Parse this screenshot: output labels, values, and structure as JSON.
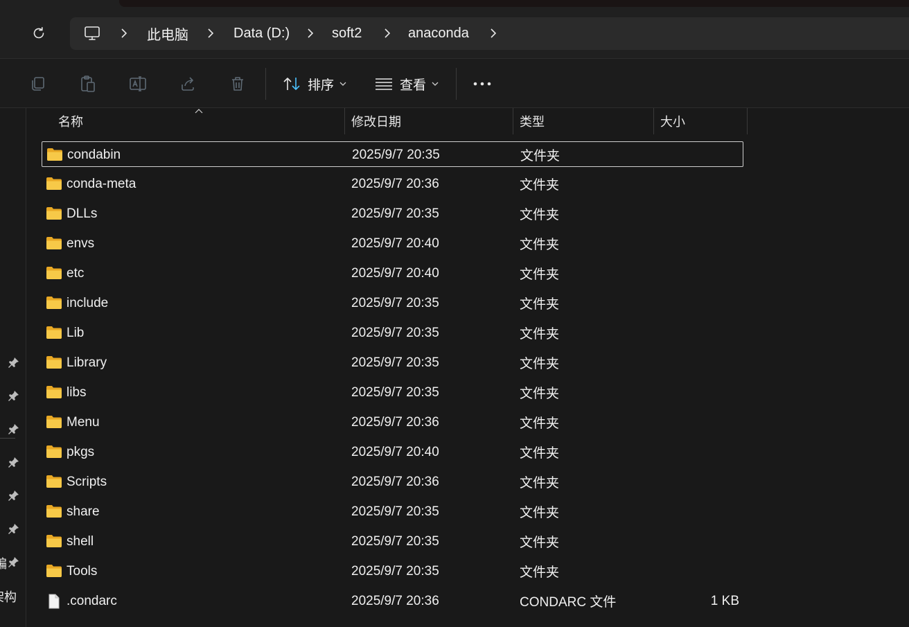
{
  "breadcrumb": {
    "items": [
      {
        "label": "此电脑"
      },
      {
        "label": "Data (D:)"
      },
      {
        "label": "soft2"
      },
      {
        "label": "anaconda"
      }
    ]
  },
  "toolbar": {
    "sort_label": "排序",
    "view_label": "查看"
  },
  "columns": {
    "name": "名称",
    "modified": "修改日期",
    "type": "类型",
    "size": "大小"
  },
  "nav": {
    "partial_text_1": "编",
    "partial_text_2": "架构"
  },
  "files": [
    {
      "name": "condabin",
      "modified": "2025/9/7 20:35",
      "type": "文件夹",
      "size": "",
      "icon": "folder-icon"
    },
    {
      "name": "conda-meta",
      "modified": "2025/9/7 20:36",
      "type": "文件夹",
      "size": "",
      "icon": "folder-icon"
    },
    {
      "name": "DLLs",
      "modified": "2025/9/7 20:35",
      "type": "文件夹",
      "size": "",
      "icon": "folder-icon"
    },
    {
      "name": "envs",
      "modified": "2025/9/7 20:40",
      "type": "文件夹",
      "size": "",
      "icon": "folder-icon"
    },
    {
      "name": "etc",
      "modified": "2025/9/7 20:40",
      "type": "文件夹",
      "size": "",
      "icon": "folder-icon"
    },
    {
      "name": "include",
      "modified": "2025/9/7 20:35",
      "type": "文件夹",
      "size": "",
      "icon": "folder-icon"
    },
    {
      "name": "Lib",
      "modified": "2025/9/7 20:35",
      "type": "文件夹",
      "size": "",
      "icon": "folder-icon"
    },
    {
      "name": "Library",
      "modified": "2025/9/7 20:35",
      "type": "文件夹",
      "size": "",
      "icon": "folder-icon"
    },
    {
      "name": "libs",
      "modified": "2025/9/7 20:35",
      "type": "文件夹",
      "size": "",
      "icon": "folder-icon"
    },
    {
      "name": "Menu",
      "modified": "2025/9/7 20:36",
      "type": "文件夹",
      "size": "",
      "icon": "folder-icon"
    },
    {
      "name": "pkgs",
      "modified": "2025/9/7 20:40",
      "type": "文件夹",
      "size": "",
      "icon": "folder-icon"
    },
    {
      "name": "Scripts",
      "modified": "2025/9/7 20:36",
      "type": "文件夹",
      "size": "",
      "icon": "folder-icon"
    },
    {
      "name": "share",
      "modified": "2025/9/7 20:35",
      "type": "文件夹",
      "size": "",
      "icon": "folder-icon"
    },
    {
      "name": "shell",
      "modified": "2025/9/7 20:35",
      "type": "文件夹",
      "size": "",
      "icon": "folder-icon"
    },
    {
      "name": "Tools",
      "modified": "2025/9/7 20:35",
      "type": "文件夹",
      "size": "",
      "icon": "folder-icon"
    },
    {
      "name": ".condarc",
      "modified": "2025/9/7 20:36",
      "type": "CONDARC 文件",
      "size": "1 KB",
      "icon": "file-icon"
    }
  ],
  "selected_index": 0,
  "colors": {
    "background": "#191919",
    "folder": "#f7c948",
    "selection_border": "#cfcfcf",
    "sort_icon_accent": "#4cc2ff"
  }
}
